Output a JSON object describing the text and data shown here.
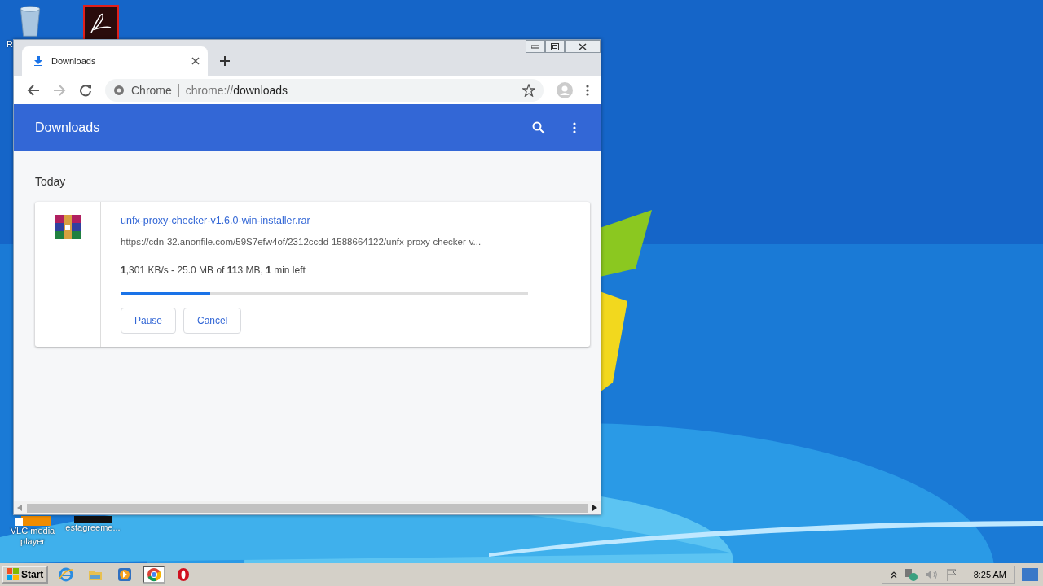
{
  "desktop": {
    "icons": [
      {
        "kind": "recycle",
        "label": "R"
      },
      {
        "kind": "pdf"
      },
      {
        "kind": "vlc",
        "label": "VLC media player"
      },
      {
        "kind": "doc",
        "label": "estagreeme..."
      }
    ]
  },
  "browser": {
    "tabs": [
      {
        "title": "Downloads",
        "selected": true
      }
    ],
    "address": {
      "site_label": "Chrome",
      "url_scheme": "chrome://",
      "url_path": "downloads"
    },
    "header": {
      "title": "Downloads"
    },
    "section": "Today",
    "downloads": [
      {
        "filename": "unfx-proxy-checker-v1.6.0-win-installer.rar",
        "url": "https://cdn-32.anonfile.com/59S7efw4of/2312ccdd-1588664122/unfx-proxy-checker-v...",
        "status": "**1**,301 KB/s - 25.0 MB of **11**3 MB, **1** min left",
        "level": 0.22,
        "buttons": [
          "Pause",
          "Cancel"
        ]
      }
    ]
  },
  "taskbar": {
    "start": "Start",
    "apps": [
      {
        "kind": "ie",
        "selected": false
      },
      {
        "kind": "folder",
        "selected": false
      },
      {
        "kind": "media",
        "selected": false
      },
      {
        "kind": "chrome",
        "selected": true
      },
      {
        "kind": "opera",
        "selected": false
      }
    ],
    "clock": "8:25 AM"
  }
}
